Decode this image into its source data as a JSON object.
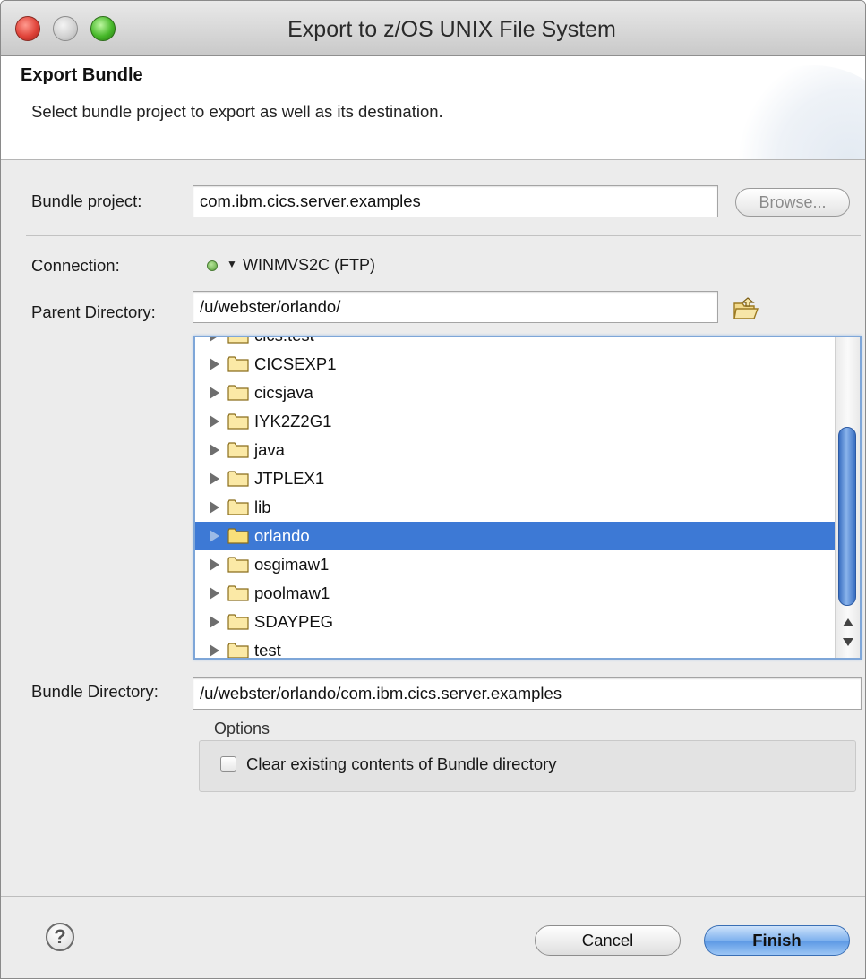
{
  "window": {
    "title": "Export to z/OS UNIX File System"
  },
  "header": {
    "title": "Export Bundle",
    "description": "Select bundle project to export as well as its destination."
  },
  "bundle_project": {
    "label": "Bundle project:",
    "value": "com.ibm.cics.server.examples",
    "browse_label": "Browse..."
  },
  "connection": {
    "label": "Connection:",
    "name": "WINMVS2C (FTP)",
    "status_color": "#5aa13b"
  },
  "parent_directory": {
    "label": "Parent Directory:",
    "value": "/u/webster/orlando/",
    "icon": "open-folder-icon"
  },
  "tree": {
    "partial_top_label": "cics.test",
    "items": [
      {
        "name": "CICSEXP1"
      },
      {
        "name": "cicsjava"
      },
      {
        "name": "IYK2Z2G1"
      },
      {
        "name": "java"
      },
      {
        "name": "JTPLEX1"
      },
      {
        "name": "lib"
      },
      {
        "name": "orlando",
        "selected": true
      },
      {
        "name": "osgimaw1"
      },
      {
        "name": "poolmaw1"
      },
      {
        "name": "SDAYPEG"
      },
      {
        "name": "test"
      }
    ]
  },
  "bundle_directory": {
    "label": "Bundle Directory:",
    "value": "/u/webster/orlando/com.ibm.cics.server.examples"
  },
  "options": {
    "title": "Options",
    "clear_contents_label": "Clear existing contents of Bundle directory",
    "clear_contents_checked": false
  },
  "footer": {
    "help_symbol": "?",
    "cancel_label": "Cancel",
    "finish_label": "Finish"
  },
  "colors": {
    "selection": "#3d79d5",
    "finish_button": "#6ea4ea"
  }
}
